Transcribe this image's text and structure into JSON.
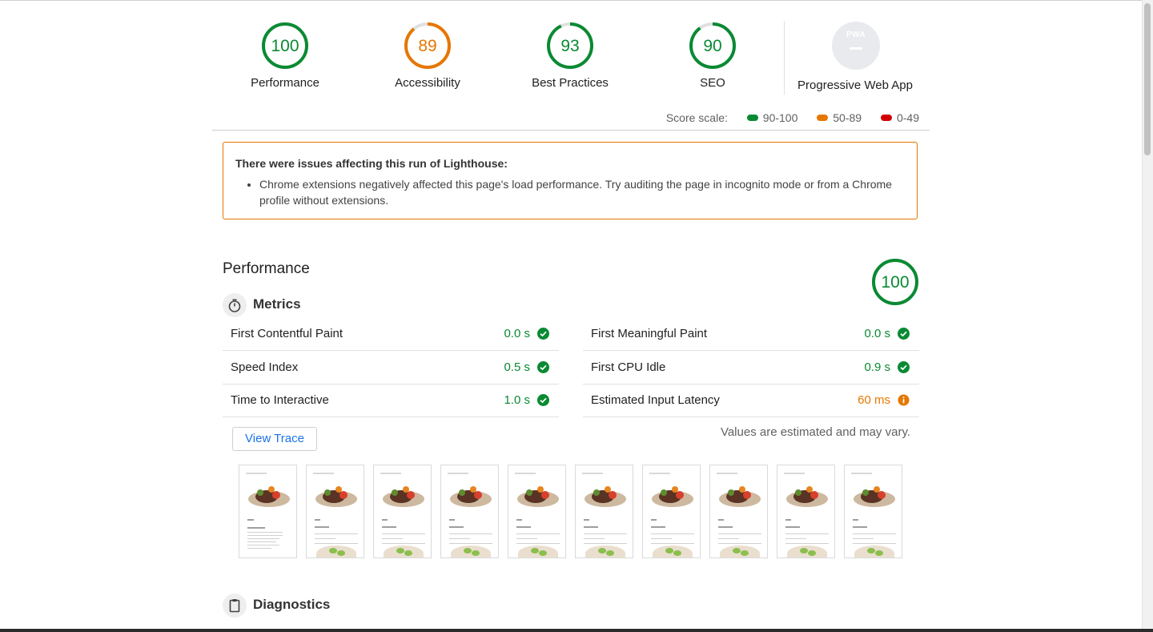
{
  "gauges": [
    {
      "label": "Performance",
      "score": "100",
      "color": "#0a8a33",
      "fraction": 1.0
    },
    {
      "label": "Accessibility",
      "score": "89",
      "color": "#e67700",
      "fraction": 0.89
    },
    {
      "label": "Best Practices",
      "score": "93",
      "color": "#0a8a33",
      "fraction": 0.93
    },
    {
      "label": "SEO",
      "score": "90",
      "color": "#0a8a33",
      "fraction": 0.9
    }
  ],
  "pwa": {
    "label": "Progressive Web App",
    "badge_text": "PWA",
    "badge_icon": "pwa-badge-icon"
  },
  "score_scale": {
    "label": "Score scale:",
    "ranges": [
      {
        "label": "90-100",
        "color": "#0a8a33"
      },
      {
        "label": "50-89",
        "color": "#e67700"
      },
      {
        "label": "0-49",
        "color": "#d10000"
      }
    ]
  },
  "warning": {
    "title": "There were issues affecting this run of Lighthouse:",
    "items": [
      "Chrome extensions negatively affected this page's load performance. Try auditing the page in incognito mode or from a Chrome profile without extensions."
    ]
  },
  "performance": {
    "title": "Performance",
    "score": "100",
    "score_fraction": 1.0,
    "metrics_title": "Metrics",
    "metrics_icon": "stopwatch-icon",
    "metrics": [
      {
        "name": "First Contentful Paint",
        "value": "0.0 s",
        "status": "pass"
      },
      {
        "name": "First Meaningful Paint",
        "value": "0.0 s",
        "status": "pass"
      },
      {
        "name": "Speed Index",
        "value": "0.5 s",
        "status": "pass"
      },
      {
        "name": "First CPU Idle",
        "value": "0.9 s",
        "status": "pass"
      },
      {
        "name": "Time to Interactive",
        "value": "1.0 s",
        "status": "pass"
      },
      {
        "name": "Estimated Input Latency",
        "value": "60 ms",
        "status": "average"
      }
    ],
    "view_trace": "View Trace",
    "note": "Values are estimated and may vary.",
    "filmstrip_frames": 10
  },
  "diagnostics": {
    "title": "Diagnostics",
    "icon": "clipboard-icon"
  }
}
